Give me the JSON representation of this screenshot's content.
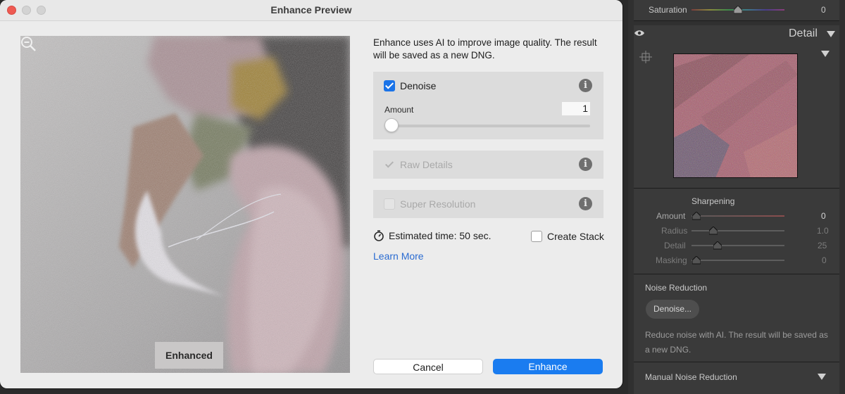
{
  "dialog": {
    "title": "Enhance Preview",
    "description": "Enhance uses AI to improve image quality. The result will be saved as a new DNG.",
    "preview_badge": "Enhanced",
    "denoise": {
      "label": "Denoise",
      "checked": true,
      "amount_label": "Amount",
      "amount_value": "1",
      "slider_level": 0.0
    },
    "raw_details": {
      "label": "Raw Details",
      "checked": true,
      "disabled": true
    },
    "super_resolution": {
      "label": "Super Resolution",
      "checked": false,
      "disabled": true
    },
    "estimated_time": "Estimated time: 50 sec.",
    "create_stack_label": "Create Stack",
    "learn_more": "Learn More",
    "cancel_label": "Cancel",
    "enhance_label": "Enhance",
    "accent": "#1a7cf0"
  },
  "panel": {
    "saturation": {
      "label": "Saturation",
      "value": "0"
    },
    "detail_title": "Detail",
    "sharpening": {
      "title": "Sharpening",
      "rows": [
        {
          "label": "Amount",
          "value": "0"
        },
        {
          "label": "Radius",
          "value": "1.0"
        },
        {
          "label": "Detail",
          "value": "25"
        },
        {
          "label": "Masking",
          "value": "0"
        }
      ]
    },
    "noise_reduction": {
      "title": "Noise Reduction",
      "button": "Denoise...",
      "description": "Reduce noise with AI. The result will be saved as a new DNG."
    },
    "manual_noise_reduction": "Manual Noise Reduction"
  }
}
